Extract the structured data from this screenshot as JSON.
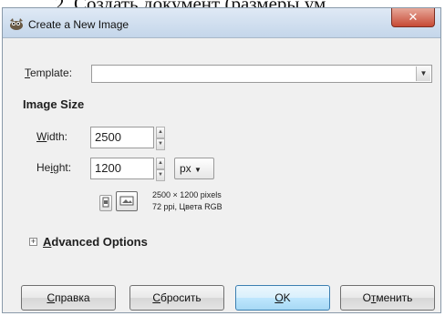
{
  "document_caption": "2. Создать документ (размеры ум",
  "dialog": {
    "title": "Create a New Image",
    "close_glyph": "✕"
  },
  "template": {
    "label_mnemonic": "T",
    "label_rest": "emplate:",
    "value": ""
  },
  "image_size": {
    "section_title": "Image Size",
    "width_label_mnemonic": "W",
    "width_label_rest": "idth:",
    "width_value": "2500",
    "height_label_pre": "He",
    "height_label_mnemonic": "i",
    "height_label_rest": "ght:",
    "height_value": "1200",
    "unit": "px",
    "info_line1": "2500 × 1200 pixels",
    "info_line2": "72 ppi, Цвета RGB"
  },
  "advanced": {
    "expander_glyph": "+",
    "label_mnemonic": "A",
    "label_rest": "dvanced Options"
  },
  "buttons": {
    "help_mnemonic": "С",
    "help_rest": "правка",
    "reset_mnemonic": "С",
    "reset_rest": "бросить",
    "ok_mnemonic": "O",
    "ok_rest": "K",
    "cancel_pre": "О",
    "cancel_mnemonic": "т",
    "cancel_rest": "менить"
  },
  "icons": [
    "gimp-wilber-icon",
    "portrait-orientation-icon",
    "landscape-orientation-icon",
    "dropdown-arrow-icon",
    "spin-up-icon",
    "spin-down-icon",
    "expander-plus-icon",
    "close-icon"
  ]
}
